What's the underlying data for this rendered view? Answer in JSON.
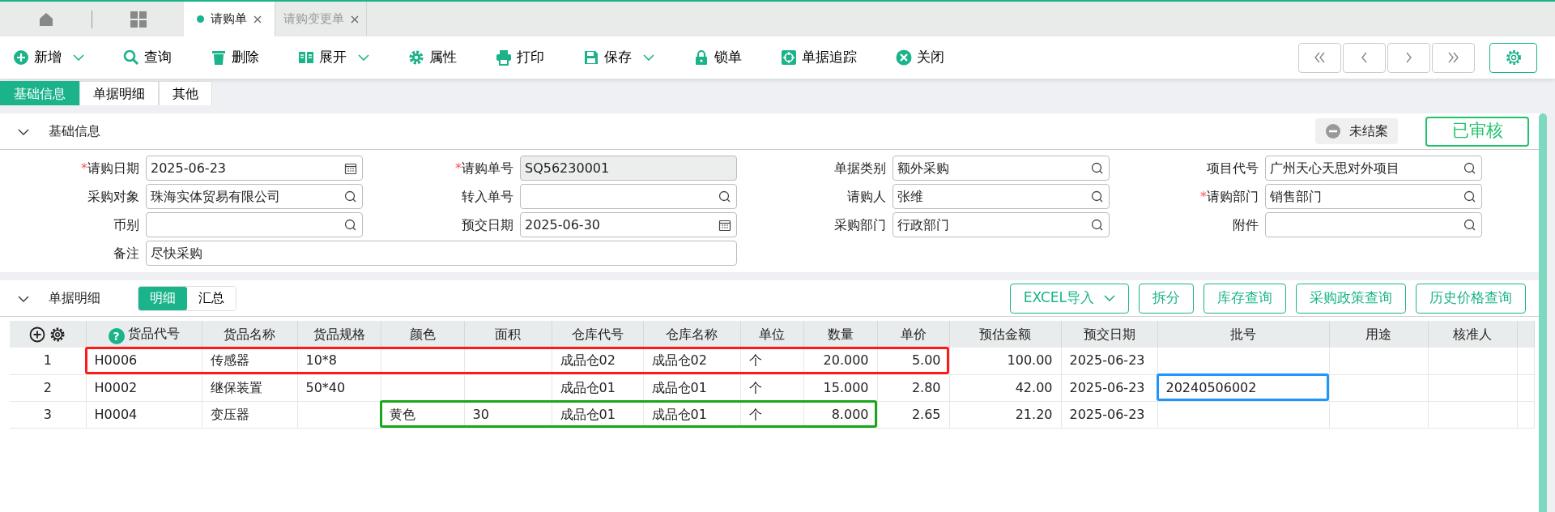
{
  "doc_tabs": [
    {
      "label": "请购单",
      "selected": true
    },
    {
      "label": "请购变更单",
      "selected": false
    }
  ],
  "toolbar": [
    {
      "kind": "add",
      "label": "新增",
      "dropdown": true
    },
    {
      "kind": "search",
      "label": "查询",
      "dropdown": false
    },
    {
      "kind": "delete",
      "label": "删除",
      "dropdown": false
    },
    {
      "kind": "expand",
      "label": "展开",
      "dropdown": true
    },
    {
      "kind": "properties",
      "label": "属性",
      "dropdown": false
    },
    {
      "kind": "print",
      "label": "打印",
      "dropdown": false
    },
    {
      "kind": "save",
      "label": "保存",
      "dropdown": true
    },
    {
      "kind": "lock",
      "label": "锁单",
      "dropdown": false
    },
    {
      "kind": "trace",
      "label": "单据追踪",
      "dropdown": false
    },
    {
      "kind": "close",
      "label": "关闭",
      "dropdown": false
    }
  ],
  "section_tabs": [
    {
      "label": "基础信息",
      "selected": true
    },
    {
      "label": "单据明细",
      "selected": false
    },
    {
      "label": "其他",
      "selected": false
    }
  ],
  "basic_section": {
    "title": "基础信息",
    "expanded": true,
    "status": "未结案",
    "approval": "已审核"
  },
  "fields": [
    {
      "label": "请购日期",
      "marker": "*",
      "kind": "date",
      "value": "2025-06-23"
    },
    {
      "label": "请购单号",
      "marker": "*",
      "kind": "readonly",
      "value": "SQ56230001"
    },
    {
      "label": "单据类别",
      "kind": "lookup",
      "value": "额外采购"
    },
    {
      "label": "项目代号",
      "kind": "lookup",
      "value": "广州天心天思对外项目"
    },
    {
      "label": "采购对象",
      "kind": "lookup",
      "value": "珠海实体贸易有限公司"
    },
    {
      "label": "转入单号",
      "kind": "lookup"
    },
    {
      "label": "请购人",
      "kind": "lookup",
      "value": "张维"
    },
    {
      "label": "请购部门",
      "marker": "*",
      "kind": "lookup",
      "value": "销售部门"
    },
    {
      "label": "币别",
      "kind": "lookup"
    },
    {
      "label": "预交日期",
      "kind": "date",
      "value": "2025-06-30"
    },
    {
      "label": "采购部门",
      "kind": "lookup",
      "value": "行政部门"
    },
    {
      "label": "附件",
      "kind": "lookup"
    },
    {
      "label": "备注",
      "kind": "memo",
      "value": "尽快采购"
    }
  ],
  "detail_section": {
    "title": "单据明细",
    "expanded": true,
    "view_tabs": [
      {
        "label": "明细",
        "selected": true
      },
      {
        "label": "汇总",
        "selected": false
      }
    ],
    "buttons": [
      {
        "label": "EXCEL导入",
        "dropdown": true
      },
      {
        "label": "拆分",
        "dropdown": false
      },
      {
        "label": "库存查询",
        "dropdown": false
      },
      {
        "label": "采购政策查询",
        "dropdown": false
      },
      {
        "label": "历史价格查询",
        "dropdown": false
      }
    ]
  },
  "table": {
    "columns": [
      {
        "kind": "controls"
      },
      {
        "kind": "text",
        "label": "货品代号",
        "help": "?"
      },
      {
        "kind": "text",
        "label": "货品名称"
      },
      {
        "kind": "text",
        "label": "货品规格"
      },
      {
        "kind": "text",
        "label": "颜色"
      },
      {
        "kind": "text",
        "label": "面积"
      },
      {
        "kind": "text",
        "label": "仓库代号"
      },
      {
        "kind": "text",
        "label": "仓库名称"
      },
      {
        "kind": "text",
        "label": "单位"
      },
      {
        "kind": "number",
        "label": "数量"
      },
      {
        "kind": "number",
        "label": "单价"
      },
      {
        "kind": "number",
        "label": "预估金额"
      },
      {
        "kind": "text",
        "label": "预交日期"
      },
      {
        "kind": "text",
        "label": "批号"
      },
      {
        "kind": "text",
        "label": "用途"
      },
      {
        "kind": "text",
        "label": "核准人"
      }
    ],
    "rows": [
      {
        "cells": [
          "1",
          "H0006",
          "传感器",
          "10*8",
          "",
          "",
          "成品仓02",
          "成品仓02",
          "个",
          "20.000",
          "5.00",
          "100.00",
          "2025-06-23",
          "",
          "",
          ""
        ],
        "color": "#ff1a1a",
        "framed": [
          false,
          true,
          true,
          true,
          true,
          true,
          true,
          true,
          true,
          true,
          true,
          false,
          false,
          false,
          false,
          false
        ]
      },
      {
        "cells": [
          "2",
          "H0002",
          "继保装置",
          "50*40",
          "",
          "",
          "成品仓01",
          "成品仓01",
          "个",
          "15.000",
          "2.80",
          "42.00",
          "2025-06-23",
          "20240506002",
          "",
          ""
        ],
        "color": "#1e96ff",
        "framed": [
          false,
          false,
          false,
          false,
          false,
          false,
          false,
          false,
          false,
          false,
          false,
          false,
          false,
          true,
          false,
          false
        ]
      },
      {
        "cells": [
          "3",
          "H0004",
          "变压器",
          "",
          "黄色",
          "30",
          "成品仓01",
          "成品仓01",
          "个",
          "8.000",
          "2.65",
          "21.20",
          "2025-06-23",
          "",
          "",
          ""
        ],
        "color": "#19a619",
        "framed": [
          false,
          false,
          false,
          false,
          true,
          true,
          true,
          true,
          true,
          true,
          false,
          false,
          false,
          false,
          false,
          false
        ]
      }
    ]
  }
}
